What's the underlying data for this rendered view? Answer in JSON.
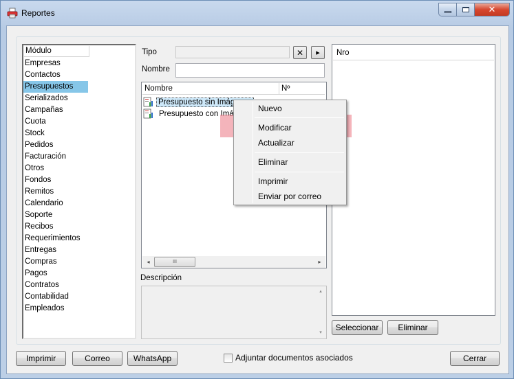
{
  "window": {
    "title": "Reportes",
    "close_glyph": "✕",
    "minimize_label": "",
    "maximize_label": ""
  },
  "modules": {
    "header": "Módulo",
    "items": [
      "Empresas",
      "Contactos",
      "Presupuestos",
      "Serializados",
      "Campañas",
      "Cuota",
      "Stock",
      "Pedidos",
      "Facturación",
      "Otros",
      "Fondos",
      "Remitos",
      "Calendario",
      "Soporte",
      "Recibos",
      "Requerimientos",
      "Entregas",
      "Compras",
      "Pagos",
      "Contratos",
      "Contabilidad",
      "Empleados"
    ],
    "selected": "Presupuestos"
  },
  "filters": {
    "tipo_label": "Tipo",
    "tipo_value": "",
    "clear_glyph": "✕",
    "go_glyph": "▸",
    "nombre_label": "Nombre",
    "nombre_value": ""
  },
  "reports": {
    "columns": [
      "Nombre",
      "Nº"
    ],
    "rows": [
      "Presupuesto sin Imágenes",
      "Presupuesto con Imágenes"
    ],
    "selected_index": 0,
    "scroll_left": "◂",
    "scroll_right": "▸",
    "thumb_grip": "III"
  },
  "description": {
    "label": "Descripción",
    "value": "",
    "up": "▴",
    "down": "▾"
  },
  "nro": {
    "header": "Nro"
  },
  "right_buttons": {
    "select": "Seleccionar",
    "delete": "Eliminar"
  },
  "context_menu": {
    "items": [
      "Nuevo",
      "Modificar",
      "Actualizar",
      "Eliminar",
      "Imprimir",
      "Enviar por correo"
    ],
    "highlighted": "Modificar"
  },
  "footer": {
    "print": "Imprimir",
    "mail": "Correo",
    "whatsapp": "WhatsApp",
    "attach_label": "Adjuntar documentos asociados",
    "attach_checked": false,
    "close": "Cerrar"
  },
  "colors": {
    "selection": "#86c6e8",
    "highlight_band": "#ee8c96",
    "close_button": "#d7472f"
  }
}
